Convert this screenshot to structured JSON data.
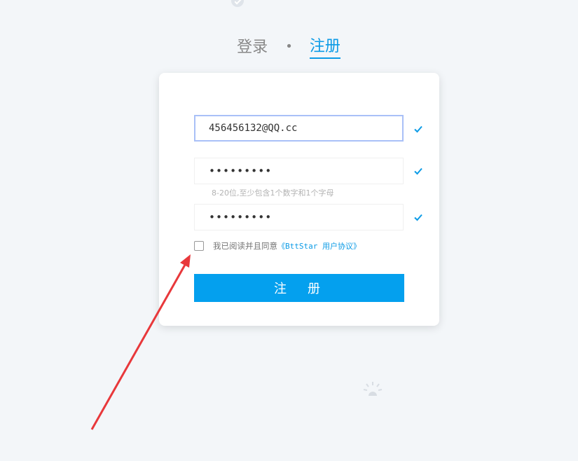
{
  "tabs": {
    "login_label": "登录",
    "separator": "•",
    "register_label": "注册",
    "active": "register"
  },
  "form": {
    "email_value": "456456132@QQ.cc",
    "password_value": "•••••••••",
    "password_hint": "8-20位,至少包含1个数字和1个字母",
    "confirm_password_value": "•••••••••",
    "agree_prefix": "我已阅读并且同意",
    "agree_link": "《BttStar 用户协议》",
    "agree_checked": false,
    "submit_label": "注册"
  },
  "icons": {
    "valid": "check-icon",
    "top_decoration": "check-circle-icon",
    "bottom_decoration": "lightbulb-icon"
  },
  "colors": {
    "accent": "#0c9be6",
    "button": "#04a0ee",
    "annotation": "#e8383b"
  }
}
